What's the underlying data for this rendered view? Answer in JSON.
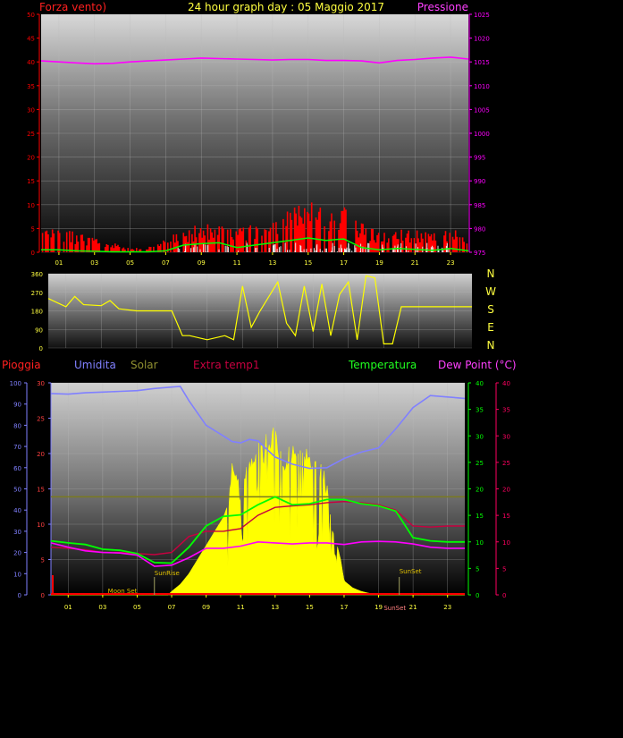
{
  "header": {
    "left_label": "Forza vento)",
    "title": "24 hour graph day : 05 Maggio 2017",
    "right_label": "Pressione"
  },
  "colors": {
    "wind": "#ff0000",
    "gust": "#ff0000",
    "avg_wind": "#00ff00",
    "pressure": "#ff00ff",
    "direction": "#ffff00",
    "rain": "#ff0000",
    "humidity": "#8080ff",
    "solar": "#ffff00",
    "extra_temp": "#c80040",
    "temperature": "#00ff00",
    "dew_point": "#ff00ff",
    "rain_axis": "#8080ff",
    "humidity_axis": "#8080ff",
    "temp_axis": "#00ff00",
    "dew_axis": "#ff0060",
    "solar_axis": "#ff0000",
    "moon_label": "#e0c000",
    "sun_label": "#e0c000"
  },
  "hours": [
    "01",
    "03",
    "05",
    "07",
    "09",
    "11",
    "13",
    "15",
    "17",
    "19",
    "21",
    "23"
  ],
  "hours2": [
    "01",
    "03",
    "05",
    "07",
    "09",
    "11",
    "13",
    "15",
    "17",
    "19",
    "21",
    "23"
  ],
  "dir_labels": [
    "N",
    "W",
    "S",
    "E",
    "N"
  ],
  "chart_data": [
    {
      "type": "line",
      "name": "wind_pressure",
      "x_axis": {
        "min": 0,
        "max": 24,
        "unit": "hour"
      },
      "y_left": {
        "label": "Forza vento)",
        "range": [
          0,
          50
        ],
        "ticks": [
          0,
          5,
          10,
          15,
          20,
          25,
          30,
          35,
          40,
          45,
          50
        ]
      },
      "y_right": {
        "label": "Pressione",
        "range": [
          975,
          1025
        ],
        "ticks": [
          975,
          980,
          985,
          990,
          995,
          1000,
          1005,
          1010,
          1015,
          1020,
          1025
        ]
      },
      "pressure": {
        "x": [
          0,
          1,
          2,
          3,
          4,
          5,
          6,
          7,
          8,
          9,
          10,
          11,
          12,
          13,
          14,
          15,
          16,
          17,
          18,
          19,
          20,
          21,
          22,
          23,
          24
        ],
        "y": [
          1015.2,
          1015.0,
          1014.8,
          1014.6,
          1014.7,
          1015.0,
          1015.2,
          1015.4,
          1015.6,
          1015.8,
          1015.7,
          1015.6,
          1015.5,
          1015.4,
          1015.5,
          1015.5,
          1015.3,
          1015.3,
          1015.2,
          1014.8,
          1015.3,
          1015.5,
          1015.8,
          1016.0,
          1015.6
        ]
      },
      "gust_envelope": {
        "x": [
          0,
          1,
          2,
          3,
          4,
          5,
          6,
          7,
          8,
          9,
          10,
          11,
          12,
          13,
          14,
          15,
          16,
          17,
          18,
          19,
          20,
          21,
          22,
          23,
          24
        ],
        "y": [
          7,
          6,
          4,
          3,
          2,
          1,
          1,
          3,
          5,
          6,
          6,
          5,
          7,
          8,
          9,
          11,
          10,
          11,
          7,
          4,
          5,
          5,
          4,
          5,
          4
        ]
      },
      "avg_wind": {
        "x": [
          0,
          1,
          2,
          3,
          4,
          5,
          6,
          7,
          8,
          9,
          10,
          11,
          12,
          13,
          14,
          15,
          16,
          17,
          18,
          19,
          20,
          21,
          22,
          23,
          24
        ],
        "y": [
          0.5,
          0.5,
          0.3,
          0.2,
          0.1,
          0.1,
          0.1,
          0.3,
          1.5,
          1.8,
          2.0,
          1.0,
          1.5,
          2.0,
          2.5,
          3.0,
          2.5,
          2.8,
          1.0,
          0.5,
          0.8,
          0.6,
          0.4,
          0.8,
          0.3
        ]
      }
    },
    {
      "type": "line",
      "name": "wind_direction",
      "x_axis": {
        "min": 0,
        "max": 24,
        "unit": "hour"
      },
      "y": {
        "range": [
          0,
          360
        ],
        "ticks": [
          0,
          90,
          180,
          270,
          360
        ]
      },
      "direction": {
        "x": [
          0,
          0.5,
          1,
          1.5,
          2,
          3,
          3.5,
          4,
          5,
          6,
          7,
          7.6,
          8,
          9,
          10,
          10.5,
          11,
          11.5,
          12,
          13,
          13.5,
          14,
          14.5,
          15,
          15.5,
          16,
          16.5,
          17,
          17.5,
          18,
          18.5,
          19,
          19.5,
          20,
          21,
          22,
          23,
          24
        ],
        "y": [
          240,
          220,
          200,
          250,
          210,
          205,
          230,
          190,
          180,
          180,
          180,
          60,
          60,
          40,
          60,
          40,
          300,
          100,
          180,
          320,
          120,
          60,
          300,
          80,
          310,
          60,
          260,
          320,
          40,
          350,
          340,
          20,
          20,
          200,
          200,
          200,
          200,
          200
        ]
      }
    },
    {
      "type": "line",
      "name": "rain_humidity_solar_temp",
      "x_axis": {
        "min": 0,
        "max": 24,
        "unit": "hour"
      },
      "series_labels": {
        "rain": "Pioggia",
        "humidity": "Umidita",
        "solar": "Solar",
        "extra_temp": "Extra temp1",
        "temperature": "Temperatura",
        "dew_point": "Dew Point (°C)"
      },
      "y_rain": {
        "range": [
          0,
          100
        ],
        "ticks": [
          0,
          10,
          20,
          30,
          40,
          50,
          60,
          70,
          80,
          90,
          100
        ]
      },
      "y_humidity": {
        "range": [
          0,
          30
        ],
        "ticks": [
          0,
          5,
          10,
          15,
          20,
          25,
          30
        ]
      },
      "y_temp": {
        "range": [
          0,
          40
        ],
        "ticks": [
          0,
          5,
          10,
          15,
          20,
          25,
          30,
          35,
          40
        ]
      },
      "y_dew": {
        "range": [
          0,
          40
        ],
        "ticks": [
          0,
          5,
          10,
          15,
          20,
          25,
          30,
          35,
          40
        ]
      },
      "humidity": {
        "x": [
          0,
          1,
          2,
          3,
          4,
          5,
          6,
          7,
          7.5,
          8,
          9,
          10,
          10.5,
          11,
          11.5,
          12,
          13,
          14,
          15,
          16,
          17,
          18,
          19,
          20,
          21,
          22,
          23,
          24
        ],
        "y": [
          28.5,
          28.4,
          28.6,
          28.7,
          28.8,
          28.9,
          29.2,
          29.4,
          29.5,
          27.5,
          24.0,
          22.5,
          21.7,
          21.5,
          22.0,
          21.8,
          19.5,
          18.5,
          17.9,
          18.0,
          19.3,
          20.2,
          20.8,
          23.5,
          26.5,
          28.2,
          28.0,
          27.8
        ]
      },
      "solar_envelope": {
        "x": [
          0,
          6.8,
          7,
          7.5,
          8,
          8.5,
          9,
          9.5,
          10,
          10.3,
          10.5,
          11,
          11.5,
          12,
          12.3,
          12.5,
          13,
          13.5,
          14,
          14.3,
          14.5,
          15,
          15.3,
          15.7,
          16,
          16.3,
          16.8,
          17,
          17.5,
          18,
          18.5,
          19,
          24
        ],
        "y": [
          0,
          0,
          0.5,
          1.5,
          3,
          5,
          7,
          9,
          11,
          13,
          20,
          15,
          20,
          22,
          21,
          23,
          24,
          20,
          22,
          21,
          22,
          21,
          20,
          19,
          16,
          10,
          5,
          2,
          1,
          0.5,
          0.2,
          0,
          0
        ]
      },
      "temperature": {
        "x": [
          0,
          1,
          2,
          3,
          4,
          5,
          6,
          7,
          8,
          9,
          10,
          11,
          12,
          13,
          14,
          15,
          16,
          17,
          18,
          19,
          20,
          21,
          22,
          23,
          24
        ],
        "y": [
          10.2,
          9.8,
          9.5,
          8.6,
          8.4,
          7.8,
          6.1,
          6.0,
          9.0,
          13.0,
          14.8,
          15.1,
          17.0,
          18.5,
          17.0,
          17.2,
          18.0,
          18.0,
          17.2,
          16.8,
          15.8,
          10.8,
          10.2,
          10.0,
          10.0
        ]
      },
      "dew_point": {
        "x": [
          0,
          1,
          2,
          3,
          4,
          5,
          6,
          7,
          8,
          9,
          10,
          11,
          12,
          13,
          14,
          15,
          16,
          17,
          18,
          19,
          20,
          21,
          22,
          23,
          24
        ],
        "y": [
          9.8,
          9.0,
          8.3,
          8.0,
          7.9,
          7.5,
          5.4,
          5.6,
          7.0,
          8.8,
          8.8,
          9.2,
          10.0,
          9.8,
          9.6,
          9.8,
          9.8,
          9.5,
          10.0,
          10.1,
          10.0,
          9.6,
          9.0,
          8.8,
          8.8
        ]
      },
      "extra_temp": {
        "x": [
          0,
          1,
          2,
          3,
          4,
          5,
          6,
          7,
          8,
          9,
          10,
          11,
          12,
          13,
          14,
          15,
          16,
          17,
          18,
          19,
          20,
          21,
          22,
          23,
          24
        ],
        "y": [
          9.0,
          8.8,
          8.5,
          8.0,
          8.0,
          7.8,
          7.6,
          8.0,
          11.0,
          12.0,
          12.0,
          12.5,
          15.0,
          16.5,
          16.8,
          17.0,
          17.4,
          17.6,
          17.4,
          17.0,
          16.0,
          13.0,
          12.8,
          13.0,
          13.0
        ]
      },
      "annotations": [
        {
          "text": "Moon Set",
          "x": 3.3
        },
        {
          "text": "SunRise",
          "x": 6.0
        },
        {
          "text": "SunSet",
          "x": 20.2
        },
        {
          "text": "SunSet",
          "x": 19.3
        }
      ]
    }
  ]
}
